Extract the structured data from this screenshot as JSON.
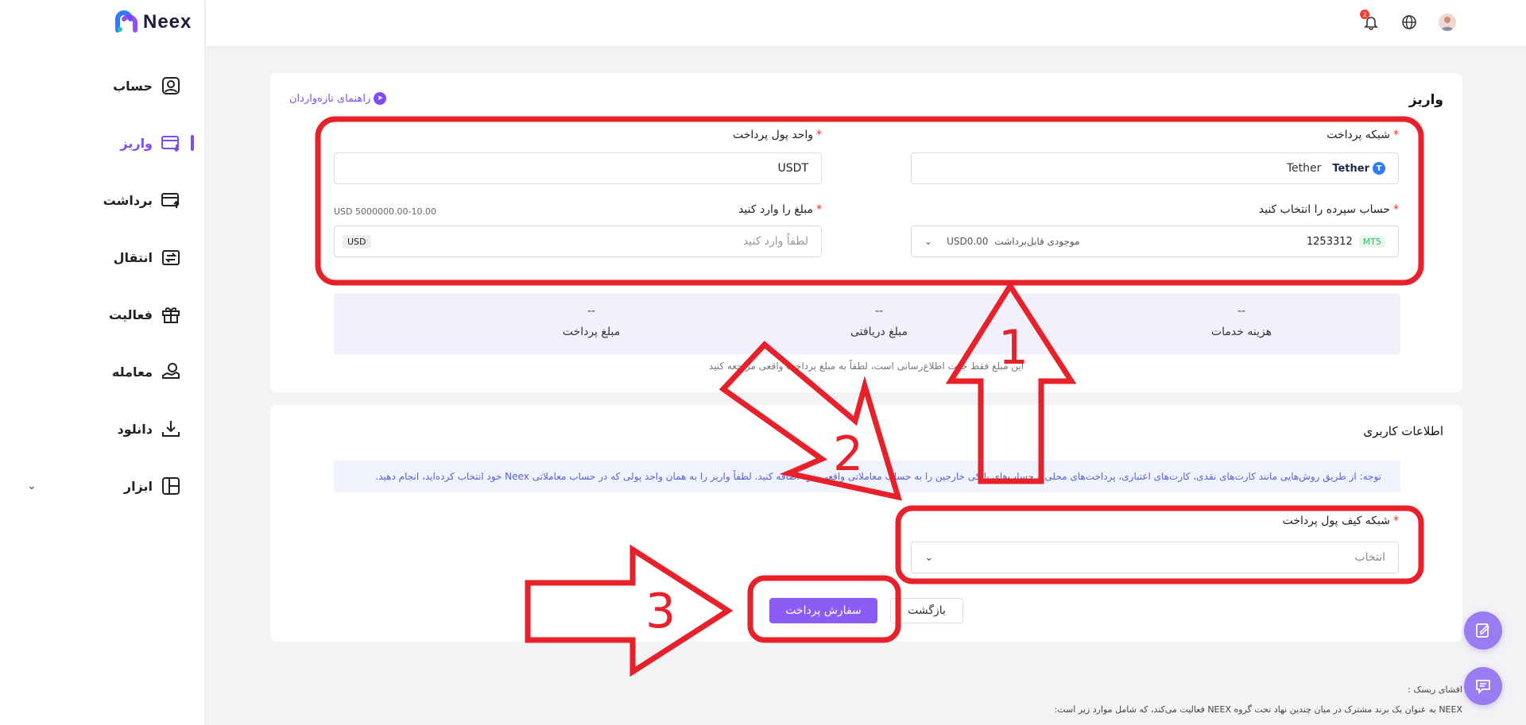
{
  "brand": {
    "name": "Neex"
  },
  "header": {
    "notification_count": "2"
  },
  "sidebar": {
    "items": [
      {
        "label": "حساب"
      },
      {
        "label": "واریز"
      },
      {
        "label": "برداشت"
      },
      {
        "label": "انتقال"
      },
      {
        "label": "فعالیت"
      },
      {
        "label": "معامله"
      },
      {
        "label": "دانلود"
      },
      {
        "label": "ابزار"
      }
    ]
  },
  "deposit": {
    "title": "واریز",
    "guide": "راهنمای تازه‌واردان",
    "network_label": "شبکه پرداخت",
    "network_value": "Tether",
    "network_brand": "Tether",
    "currency_label": "واحد پول پرداخت",
    "currency_value": "USDT",
    "account_label": "حساب سپرده را انتخاب کنید",
    "account_tag": "MT5",
    "account_number": "1253312",
    "account_balance_label": "موجودی قابل‌برداشت",
    "account_balance": "USD0.00",
    "amount_label": "مبلغ را وارد کنید",
    "amount_range": "USD 5000000.00-10.00",
    "amount_placeholder": "لطفاً وارد کنید",
    "amount_unit": "USD",
    "summary": [
      {
        "value": "--",
        "label": "هزینه خدمات"
      },
      {
        "value": "--",
        "label": "مبلغ دریافتی"
      },
      {
        "value": "--",
        "label": "مبلغ پرداخت"
      }
    ],
    "disclaimer": "این مبلغ فقط جهت اطلاع‌رسانی است، لطفاً به مبلغ پرداخت واقعی مراجعه کنید"
  },
  "user_info": {
    "title": "اطلاعات کاربری",
    "notice": "توجه: از طریق روش‌هایی مانند کارت‌های نقدی، کارت‌های اعتباری، پرداخت‌های محلی و حساب‌های بانکی خارجین را به حساب معاملاتی واقعی خود اضافه کنید. لطفاً واریز را به همان واحد پولی که در حساب معاملاتی Neex خود انتخاب کرده‌اید، انجام دهید.",
    "wallet_label": "شبکه کیف پول پرداخت",
    "wallet_placeholder": "انتخاب",
    "back_button": "بازگشت",
    "submit_button": "سفارش پرداخت"
  },
  "risk": {
    "title": "افشای ریسک :",
    "text": "NEEX به عنوان یک برند مشترک در میان چندین نهاد تحت گروه NEEX فعالیت می‌کند، که شامل موارد زیر است:"
  },
  "annotations": {
    "label_1": "1",
    "label_2": "2",
    "label_3": "3",
    "color": "#e8202a"
  },
  "colors": {
    "accent": "#7d4cf6"
  }
}
